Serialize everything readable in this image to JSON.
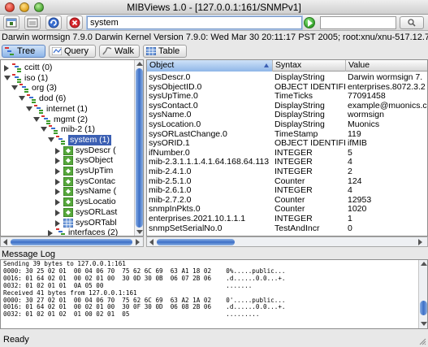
{
  "window": {
    "title": "MIBViews 1.0 - [127.0.0.1:161/SNMPv1]"
  },
  "toolbar": {
    "search_value": "system",
    "secondary_value": ""
  },
  "description": "Darwin wormsign 7.9.0 Darwin Kernel Version 7.9.0: Wed Mar 30 20:11:17 PST 2005; root:xnu/xnu-517.12.7.obj~1/REL",
  "tabs": [
    {
      "label": "Tree",
      "active": true
    },
    {
      "label": "Query",
      "active": false
    },
    {
      "label": "Walk",
      "active": false
    },
    {
      "label": "Table",
      "active": false
    }
  ],
  "tree": {
    "nodes": [
      {
        "label": "ccitt (0)",
        "depth": 0,
        "expanded": false,
        "icon": "branch-icon"
      },
      {
        "label": "iso (1)",
        "depth": 0,
        "expanded": true,
        "icon": "branch-icon"
      },
      {
        "label": "org (3)",
        "depth": 1,
        "expanded": true,
        "icon": "branch-icon"
      },
      {
        "label": "dod (6)",
        "depth": 2,
        "expanded": true,
        "icon": "branch-icon"
      },
      {
        "label": "internet (1)",
        "depth": 3,
        "expanded": true,
        "icon": "branch-icon"
      },
      {
        "label": "mgmt (2)",
        "depth": 4,
        "expanded": true,
        "icon": "branch-icon"
      },
      {
        "label": "mib-2 (1)",
        "depth": 5,
        "expanded": true,
        "icon": "branch-icon"
      },
      {
        "label": "system (1)",
        "depth": 6,
        "expanded": true,
        "icon": "branch-icon",
        "selected": true
      },
      {
        "label": "sysDescr (",
        "depth": 7,
        "expanded": false,
        "icon": "leaf-icon"
      },
      {
        "label": "sysObject",
        "depth": 7,
        "expanded": false,
        "icon": "leaf-icon"
      },
      {
        "label": "sysUpTim",
        "depth": 7,
        "expanded": false,
        "icon": "leaf-icon"
      },
      {
        "label": "sysContac",
        "depth": 7,
        "expanded": false,
        "icon": "leaf-icon"
      },
      {
        "label": "sysName (",
        "depth": 7,
        "expanded": false,
        "icon": "leaf-icon"
      },
      {
        "label": "sysLocatio",
        "depth": 7,
        "expanded": false,
        "icon": "leaf-icon"
      },
      {
        "label": "sysORLast",
        "depth": 7,
        "expanded": false,
        "icon": "leaf-icon"
      },
      {
        "label": "sysORTabl",
        "depth": 7,
        "expanded": false,
        "icon": "table-icon"
      },
      {
        "label": "interfaces (2)",
        "depth": 6,
        "expanded": false,
        "icon": "branch-icon"
      }
    ]
  },
  "table": {
    "columns": [
      "Object",
      "Syntax",
      "Value"
    ],
    "rows": [
      [
        "sysDescr.0",
        "DisplayString",
        "Darwin wormsign 7."
      ],
      [
        "sysObjectID.0",
        "OBJECT IDENTIFIER",
        "enterprises.8072.3.2"
      ],
      [
        "sysUpTime.0",
        "TimeTicks",
        "77091458"
      ],
      [
        "sysContact.0",
        "DisplayString",
        "example@muonics.c"
      ],
      [
        "sysName.0",
        "DisplayString",
        "wormsign"
      ],
      [
        "sysLocation.0",
        "DisplayString",
        "Muonics"
      ],
      [
        "sysORLastChange.0",
        "TimeStamp",
        "119"
      ],
      [
        "sysORID.1",
        "OBJECT IDENTIFIER",
        "ifMIB"
      ],
      [
        "ifNumber.0",
        "INTEGER",
        "5"
      ],
      [
        "mib-2.3.1.1.1.4.1.64.168.64.113",
        "INTEGER",
        "4"
      ],
      [
        "mib-2.4.1.0",
        "INTEGER",
        "2"
      ],
      [
        "mib-2.5.1.0",
        "Counter",
        "124"
      ],
      [
        "mib-2.6.1.0",
        "INTEGER",
        "4"
      ],
      [
        "mib-2.7.2.0",
        "Counter",
        "12953"
      ],
      [
        "snmpInPkts.0",
        "Counter",
        "1020"
      ],
      [
        "enterprises.2021.10.1.1.1",
        "INTEGER",
        "1"
      ],
      [
        "snmpSetSerialNo.0",
        "TestAndIncr",
        "0"
      ]
    ]
  },
  "log": {
    "label": "Message Log",
    "lines": [
      "Sending 39 bytes to 127.0.0.1:161",
      "0000: 30 25 02 01  00 04 06 70  75 62 6C 69  63 A1 18 02    0%.....public...",
      "0016: 01 64 02 01  00 02 01 00  30 0D 30 0B  06 07 2B 06    .d......0.0...+.",
      "0032: 01 02 01 01  0A 05 00                                 .......",
      "Received 41 bytes from 127.0.0.1:161",
      "0000: 30 27 02 01  00 04 06 70  75 62 6C 69  63 A2 1A 02    0'.....public...",
      "0016: 01 64 02 01  00 02 01 00  30 0F 30 0D  06 08 2B 06    .d......0.0...+.",
      "0032: 01 02 01 02  01 00 02 01  05                          ........."
    ]
  },
  "status": {
    "text": "Ready"
  }
}
